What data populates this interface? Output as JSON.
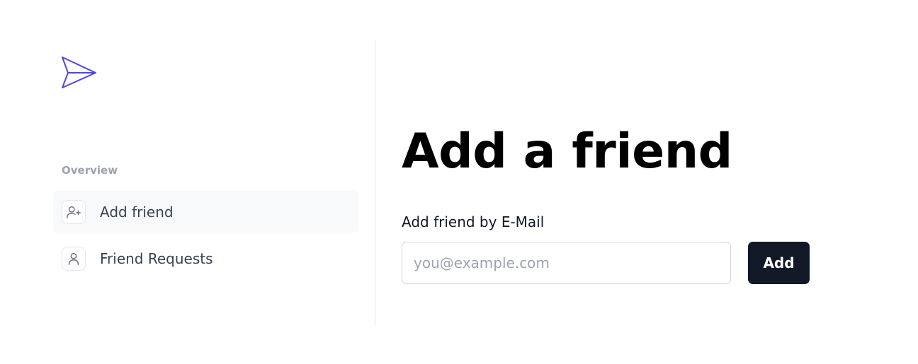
{
  "logo": {
    "icon": "paper-plane-icon",
    "color": "#4f46e5"
  },
  "sidebar": {
    "section_label": "Overview",
    "items": [
      {
        "label": "Add friend",
        "icon": "user-plus-icon",
        "active": true
      },
      {
        "label": "Friend Requests",
        "icon": "user-icon",
        "active": false
      }
    ]
  },
  "main": {
    "title": "Add a friend",
    "field_label": "Add friend by E-Mail",
    "email_placeholder": "you@example.com",
    "email_value": "",
    "add_button_label": "Add"
  },
  "colors": {
    "accent": "#4f46e5",
    "button_bg": "#111827",
    "active_item_bg": "#f8f9fb",
    "divider": "#e5e7eb"
  }
}
